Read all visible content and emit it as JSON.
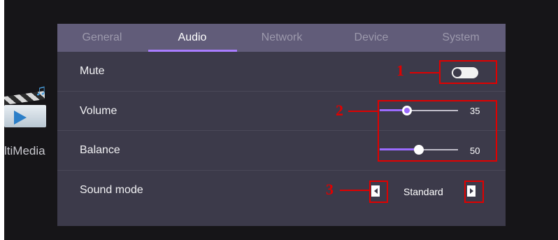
{
  "tabs": [
    {
      "label": "General"
    },
    {
      "label": "Audio"
    },
    {
      "label": "Network"
    },
    {
      "label": "Device"
    },
    {
      "label": "System"
    }
  ],
  "active_tab": "Audio",
  "background_app": {
    "label": "ltiMedia",
    "icon": "multimedia-clapperboard-icon"
  },
  "settings": {
    "mute": {
      "label": "Mute",
      "on": false
    },
    "volume": {
      "label": "Volume",
      "value": "35",
      "level": 0.35
    },
    "balance": {
      "label": "Balance",
      "value": "50",
      "level": 0.5
    },
    "sound_mode": {
      "label": "Sound mode",
      "value": "Standard"
    }
  },
  "annotations": [
    "1",
    "2",
    "3"
  ],
  "colors": {
    "panel": "#3c3a4a",
    "tab_bar": "#615c79",
    "accent": "#9b6bff",
    "annotation": "#e00000"
  }
}
